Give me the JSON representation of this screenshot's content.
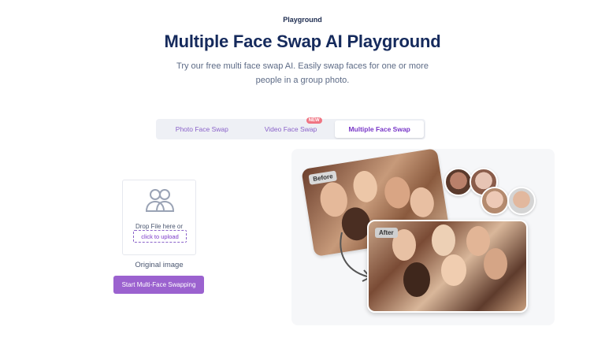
{
  "header": {
    "eyebrow": "Playground",
    "title": "Multiple Face Swap AI Playground",
    "subtitle": "Try our free multi face swap AI. Easily swap faces for one or more people in a group photo."
  },
  "tabs": [
    {
      "label": "Photo Face Swap",
      "active": false
    },
    {
      "label": "Video Face Swap",
      "active": false,
      "badge": "NEW"
    },
    {
      "label": "Multiple Face Swap",
      "active": true
    }
  ],
  "upload": {
    "drop_text": "Drop File here or",
    "link_text": "click to upload",
    "caption": "Original image",
    "icon": "users-icon"
  },
  "actions": {
    "start_label": "Start Multi-Face Swapping"
  },
  "preview": {
    "before_label": "Before",
    "after_label": "After"
  },
  "colors": {
    "accent": "#9b62cf",
    "title": "#152a5c",
    "badge": "#f07583"
  }
}
